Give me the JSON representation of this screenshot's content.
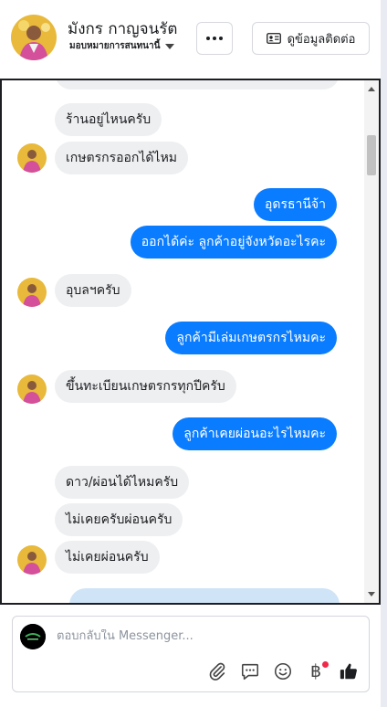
{
  "header": {
    "contact_name": "มังกร กาญจนรัต",
    "assign_label": "มอบหมายการสนทนานี้",
    "more_icon": "ellipsis-icon",
    "view_contact_label": "ดูข้อมูลติดต่อ"
  },
  "messages": [
    {
      "side": "in",
      "text": "ร้านอยู่ไหนครับ"
    },
    {
      "side": "in",
      "text": "เกษตรกรออกได้ไหม"
    },
    {
      "side": "out",
      "text": "อุดรธานีจ้า"
    },
    {
      "side": "out",
      "text": "ออกได้ค่ะ ลูกค้าอยู่จังหวัดอะไรคะ"
    },
    {
      "side": "in",
      "text": "อุบลฯครับ"
    },
    {
      "side": "out",
      "text": "ลูกค้ามีเล่มเกษตรกรไหมคะ"
    },
    {
      "side": "in",
      "text": "ขึ้นทะเบียนเกษตรกรทุกปีครับ"
    },
    {
      "side": "out",
      "text": "ลูกค้าเคยผ่อนอะไรไหมคะ"
    },
    {
      "side": "in",
      "text": "ดาว/ผ่อนได้ไหมครับ"
    },
    {
      "side": "in",
      "text": "ไม่เคยครับผ่อนครับ"
    },
    {
      "side": "in",
      "text": "ไม่เคยผ่อนครับ"
    }
  ],
  "composer": {
    "placeholder": "ตอบกลับใน Messenger...",
    "currency_symbol": "฿"
  },
  "colors": {
    "outgoing_bubble": "#0a7cff",
    "incoming_bubble": "#eeeff1",
    "notification_dot": "#f02849"
  }
}
